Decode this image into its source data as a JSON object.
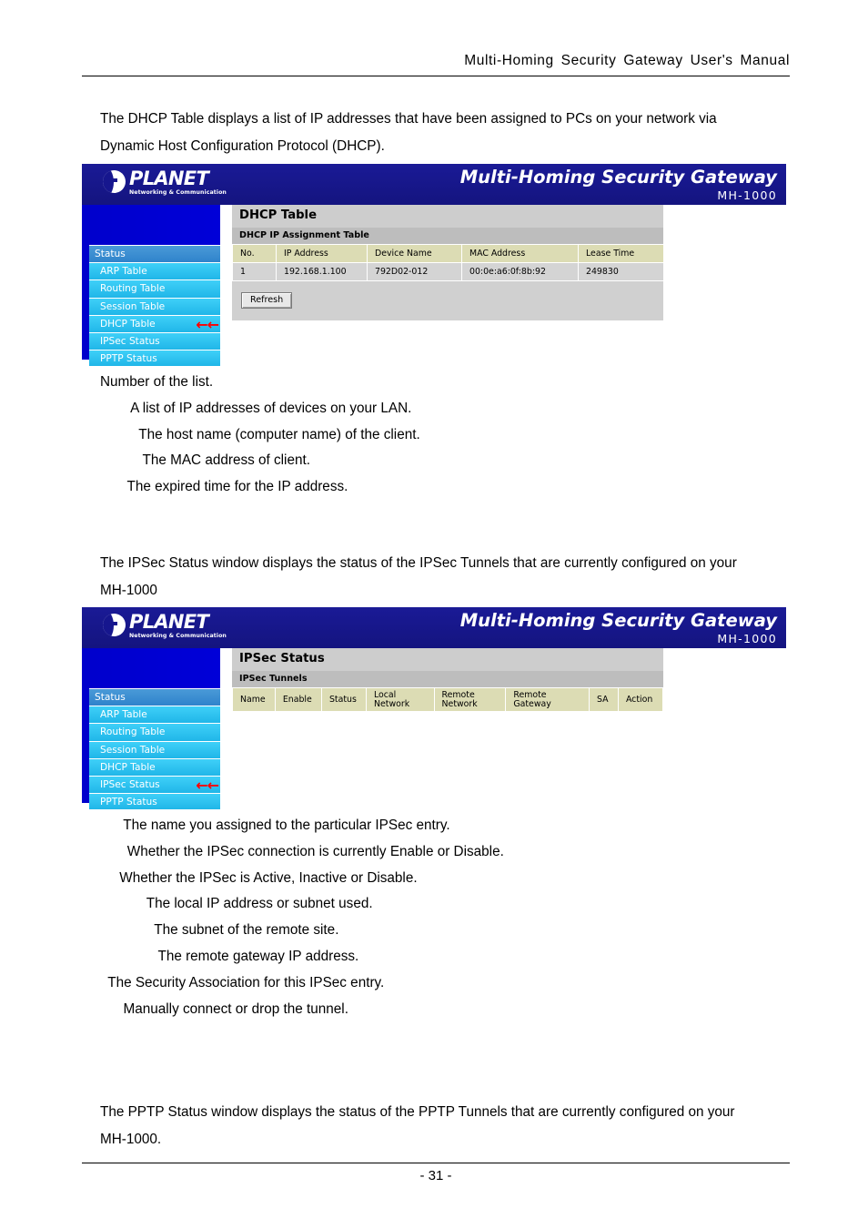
{
  "header": {
    "title": "Multi-Homing  Security  Gateway  User's  Manual"
  },
  "footer": {
    "page_number": "- 31 -"
  },
  "paragraphs": {
    "dhcp_intro_line1": "The DHCP Table displays a list of IP addresses that have been assigned to PCs on your network via",
    "dhcp_intro_line2": "Dynamic Host Configuration Protocol (DHCP).",
    "ipsec_intro_line1": "The IPSec Status window displays the status of the IPSec Tunnels that are currently configured on your",
    "ipsec_intro_line2": "MH-1000",
    "pptp_intro_line1": "The PPTP Status window displays the status of the PPTP Tunnels that are currently configured on your",
    "pptp_intro_line2": "MH-1000."
  },
  "dhcp_field_descriptions": [
    "Number of the list.",
    "        A list of IP addresses of devices on your LAN.",
    "          The host name (computer name) of the client.",
    "           The MAC address of client.",
    "       The expired time for the IP address."
  ],
  "ipsec_field_descriptions": [
    "      The name you assigned to the particular IPSec entry.",
    "       Whether the IPSec connection is currently Enable or Disable.",
    "     Whether the IPSec is Active, Inactive or Disable.",
    "            The local IP address or subnet used.",
    "              The subnet of the remote site.",
    "               The remote gateway IP address.",
    "  The Security Association for this IPSec entry.",
    "      Manually connect or drop the tunnel."
  ],
  "device_ui": {
    "banner": {
      "logo_name": "PLANET",
      "logo_tagline": "Networking & Communication",
      "product_name": "Multi-Homing Security Gateway",
      "model_number": "MH-1000"
    },
    "nav": {
      "group_label": "Status",
      "items": [
        {
          "label": "ARP Table",
          "selected": false
        },
        {
          "label": "Routing Table",
          "selected": false
        },
        {
          "label": "Session Table",
          "selected": false
        },
        {
          "label": "DHCP Table",
          "selected": true
        },
        {
          "label": "IPSec Status",
          "selected": false
        },
        {
          "label": "PPTP Status",
          "selected": false
        }
      ],
      "selected_dhcp": "DHCP Table",
      "selected_ipsec": "IPSec Status",
      "pointer_glyph": "←←"
    },
    "dhcp_panel": {
      "title": "DHCP Table",
      "subtitle": "DHCP IP Assignment Table",
      "columns": [
        "No.",
        "IP Address",
        "Device Name",
        "MAC Address",
        "Lease Time"
      ],
      "rows": [
        [
          "1",
          "192.168.1.100",
          "792D02-012",
          "00:0e:a6:0f:8b:92",
          "249830"
        ]
      ],
      "refresh_label": "Refresh"
    },
    "ipsec_panel": {
      "title": "IPSec Status",
      "subtitle": "IPSec Tunnels",
      "columns": [
        {
          "line1": "Name",
          "line2": ""
        },
        {
          "line1": "Enable",
          "line2": ""
        },
        {
          "line1": "Status",
          "line2": ""
        },
        {
          "line1": "Local",
          "line2": "Network"
        },
        {
          "line1": "Remote",
          "line2": "Network"
        },
        {
          "line1": "Remote",
          "line2": "Gateway"
        },
        {
          "line1": "SA",
          "line2": ""
        },
        {
          "line1": "Action",
          "line2": ""
        }
      ],
      "rows": []
    }
  },
  "colors": {
    "banner_blue": "#16168e",
    "nav_blue": "#0000cc",
    "nav_group": "#3a8fd4",
    "nav_leaf": "#2fc4f0",
    "panel_title_gray": "#cdcdcd",
    "panel_subtitle_gray": "#bdbdbd",
    "table_header_khaki": "#dcdcb4",
    "table_cell_gray": "#d4d4d4",
    "pointer_red": "#ff0000"
  }
}
